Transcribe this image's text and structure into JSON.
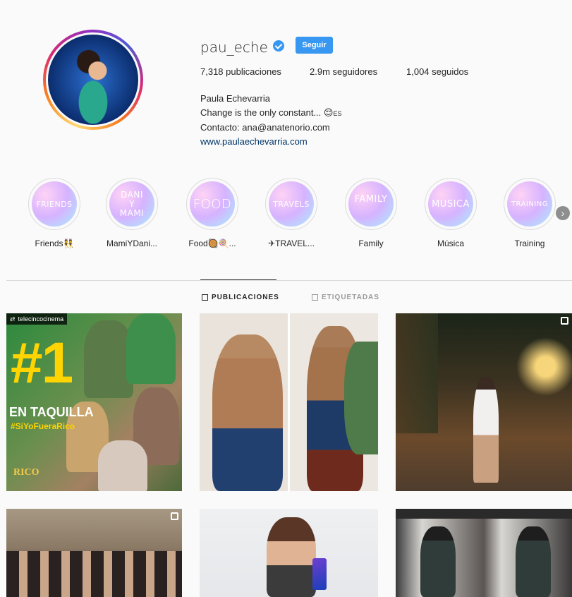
{
  "profile": {
    "username": "pau_eche",
    "follow_label": "Seguir",
    "stats": {
      "posts": "7,318 publicaciones",
      "followers": "2.9m seguidores",
      "following": "1,004 seguidos"
    },
    "bio": {
      "name": "Paula Echevarria",
      "line1": "Change is the only constant... 😌",
      "line1_suffix": "ES",
      "contact": "Contacto: ana@anatenorio.com",
      "website": "www.paulaechevarria.com"
    }
  },
  "highlights": [
    {
      "cover": "FRIENDS",
      "label": "Friends👯"
    },
    {
      "cover": "DANI\nY\nMAMI",
      "label": "MamiYDani..."
    },
    {
      "cover": "FOOD",
      "label": "Food🥘🍭..."
    },
    {
      "cover": "TRAVELS",
      "label": "✈TRAVEL..."
    },
    {
      "cover": "FAMILY",
      "label": "Family"
    },
    {
      "cover": "MUSICA",
      "label": "Música"
    },
    {
      "cover": "TRAINING",
      "label": "Training"
    }
  ],
  "tabs": {
    "posts": "PUBLICACIONES",
    "tagged": "ETIQUETADAS"
  },
  "posts": {
    "p1": {
      "badge": "telecincocinema",
      "big": "#1",
      "line1": "EN TAQUILLA",
      "line2": "#SiYoFueraRico",
      "logo": "RICO"
    }
  },
  "colors": {
    "accent": "#3897f0",
    "link": "#003569",
    "text": "#262626",
    "muted": "#999999",
    "border": "#dbdbdb"
  }
}
